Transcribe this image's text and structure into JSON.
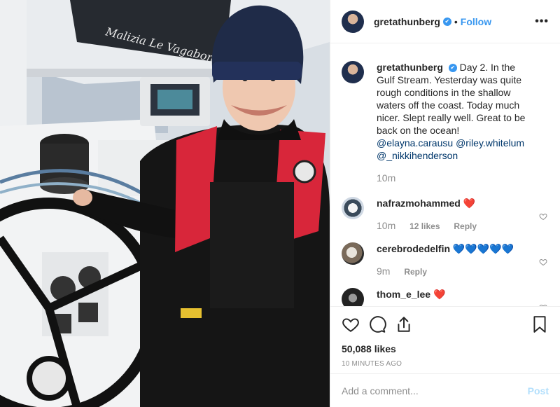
{
  "photo": {
    "alt_text": "",
    "sail_text": "Malizia Le Vagabonde"
  },
  "header": {
    "username": "gretathunberg",
    "verified_glyph": "✔",
    "separator": "•",
    "follow_label": "Follow",
    "more_glyph": "•••"
  },
  "caption": {
    "username": "gretathunberg",
    "text_1": "Day 2. In the Gulf Stream. Yesterday was quite rough conditions in the shallow waters off the coast. Today much nicer. Slept really well. Great to be back on the ocean! ",
    "mention_1": "@elayna.carausu",
    "mention_2": "@riley.whitelum",
    "mention_3": "@_nikkihenderson",
    "time": "10m"
  },
  "comments": [
    {
      "username": "nafrazmohammed",
      "text": "❤️",
      "time": "10m",
      "likes": "12 likes",
      "reply": "Reply"
    },
    {
      "username": "cerebrodedelfin",
      "text": "💙💙💙💙💙",
      "time": "9m",
      "reply": "Reply"
    },
    {
      "username": "thom_e_lee",
      "text": "❤️"
    }
  ],
  "actions": {
    "likes": "50,088 likes",
    "timestamp": "10 minutes ago"
  },
  "add_comment": {
    "placeholder": "Add a comment...",
    "post_label": "Post"
  },
  "colors": {
    "accent": "#3897f0",
    "post_disabled": "#b2dffc",
    "text": "#262626",
    "muted": "#8e8e8e"
  }
}
